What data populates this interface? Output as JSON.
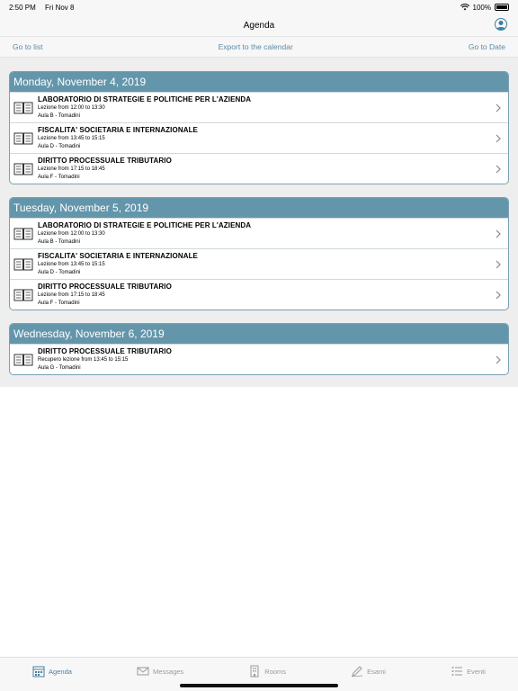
{
  "status_bar": {
    "time": "2:50 PM",
    "date": "Fri Nov 8",
    "battery": "100%"
  },
  "nav": {
    "title": "Agenda"
  },
  "toolbar": {
    "go_to_list": "Go to list",
    "export": "Export to the calendar",
    "go_to_date": "Go to Date"
  },
  "days": [
    {
      "header": "Monday, November 4, 2019",
      "events": [
        {
          "title": "LABORATORIO DI STRATEGIE E POLITICHE PER L'AZIENDA",
          "time": "Lezione from 12:00 to 13:30",
          "room": "Aula B - Tomadini"
        },
        {
          "title": "FISCALITA' SOCIETARIA E INTERNAZIONALE",
          "time": "Lezione from 13:45 to 15:15",
          "room": "Aula D - Tomadini"
        },
        {
          "title": "DIRITTO PROCESSUALE TRIBUTARIO",
          "time": "Lezione from 17:15 to 18:45",
          "room": "Aula F - Tomadini"
        }
      ]
    },
    {
      "header": "Tuesday, November 5, 2019",
      "events": [
        {
          "title": "LABORATORIO DI STRATEGIE E POLITICHE PER L'AZIENDA",
          "time": "Lezione from 12:00 to 13:30",
          "room": "Aula B - Tomadini"
        },
        {
          "title": "FISCALITA' SOCIETARIA E INTERNAZIONALE",
          "time": "Lezione from 13:45 to 15:15",
          "room": "Aula D - Tomadini"
        },
        {
          "title": "DIRITTO PROCESSUALE TRIBUTARIO",
          "time": "Lezione from 17:15 to 18:45",
          "room": "Aula F - Tomadini"
        }
      ]
    },
    {
      "header": "Wednesday, November 6, 2019",
      "events": [
        {
          "title": "DIRITTO PROCESSUALE TRIBUTARIO",
          "time": "Recupero lezione from 13:45 to 15:15",
          "room": "Aula G - Tomadini"
        }
      ]
    }
  ],
  "tabs": [
    {
      "label": "Agenda",
      "icon": "calendar-icon",
      "active": true
    },
    {
      "label": "Messages",
      "icon": "envelope-icon",
      "active": false
    },
    {
      "label": "Rooms",
      "icon": "building-icon",
      "active": false
    },
    {
      "label": "Esami",
      "icon": "pen-icon",
      "active": false
    },
    {
      "label": "Eventi",
      "icon": "list-icon",
      "active": false
    }
  ],
  "colors": {
    "accent": "#6496ab",
    "link": "#5a8ca6",
    "active_tab": "#4a7fa0"
  }
}
